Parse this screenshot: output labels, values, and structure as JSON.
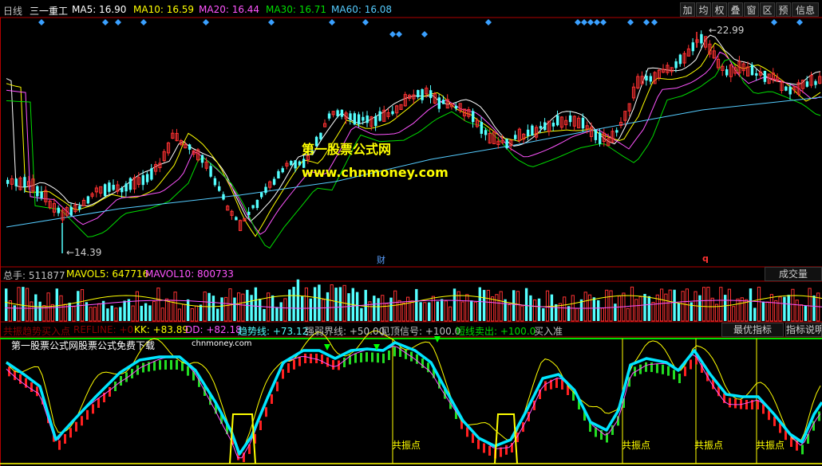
{
  "header": {
    "period": "日线",
    "stock_name": "三一重工",
    "ma": [
      {
        "label": "MA5: 16.90",
        "color": "#ffffff"
      },
      {
        "label": "MA10: 16.59",
        "color": "#ffff00"
      },
      {
        "label": "MA20: 16.44",
        "color": "#ff55ff"
      },
      {
        "label": "MA30: 16.71",
        "color": "#00dd00"
      },
      {
        "label": "MA60: 16.08",
        "color": "#55ccff"
      }
    ],
    "toolbar": [
      "加",
      "均",
      "权",
      "叠",
      "窗",
      "区",
      "预",
      "信息"
    ]
  },
  "price_chart": {
    "high_label": "22.99",
    "low_label": "14.39",
    "marker_cai": "财",
    "marker_q": "q"
  },
  "watermark": {
    "line1": "第一股票公式网",
    "line2": "www.chnmoney.com"
  },
  "volume": {
    "total_label": "总手: 511877",
    "mavol5_label": "MAVOL5: 647716",
    "mavol10_label": "MAVOL10: 800733",
    "button": "成交量"
  },
  "indicator": {
    "title": "共振趋势买入点",
    "refline": "REFLINE: +0",
    "kk": "KK: +83.89",
    "dd": "DD: +82.18",
    "trend": "趋势线: +73.12",
    "strong_weak": "强弱界线: +50.00",
    "top_signal": "见顶信号: +100.0",
    "short_sell": "短线卖出: +100.0",
    "buy_ready": "买入准",
    "btn_best": "最优指标",
    "btn_desc": "指标说明",
    "banner": "第一股票公式网股票公式免费下载",
    "banner_site": "chnmoney.com",
    "resonance_label": "共振点"
  },
  "colors": {
    "up": "#ff3232",
    "down": "#54ffff",
    "border": "#b00000"
  }
}
